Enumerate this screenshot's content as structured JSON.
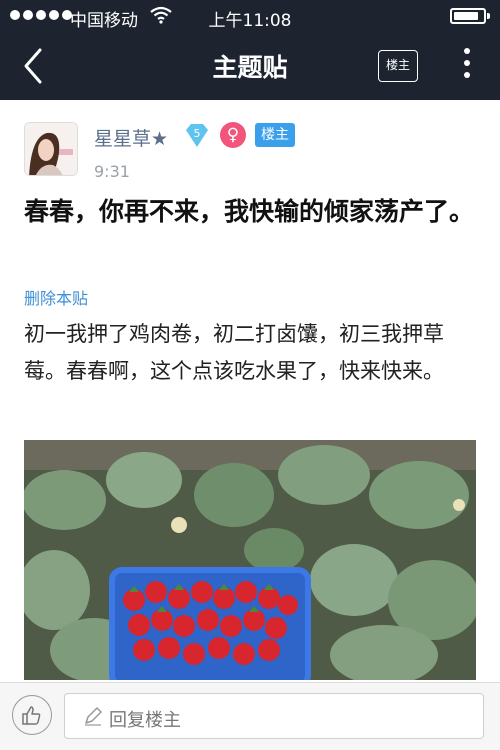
{
  "status_bar": {
    "carrier": "中国移动",
    "time": "上午11:08"
  },
  "nav": {
    "title": "主题贴",
    "op_button_label": "楼主"
  },
  "post": {
    "author": {
      "name": "星星草★",
      "level": "5",
      "gender_symbol": "♀",
      "op_badge": "楼主"
    },
    "time": "9:31",
    "title": "春春，你再不来，我快输的倾家荡产了。",
    "delete_link": "删除本贴",
    "body": "初一我押了鸡肉卷，初二打卤馕，初三我押草莓。春春啊，这个点该吃水果了，快来快来。"
  },
  "bottom_bar": {
    "reply_placeholder": "回复楼主"
  },
  "colors": {
    "nav_bg": "#1d2430",
    "link": "#3d8fd6",
    "username": "#5b6e8c",
    "op_badge": "#3aa0ec",
    "gender_badge": "#f1557c"
  }
}
